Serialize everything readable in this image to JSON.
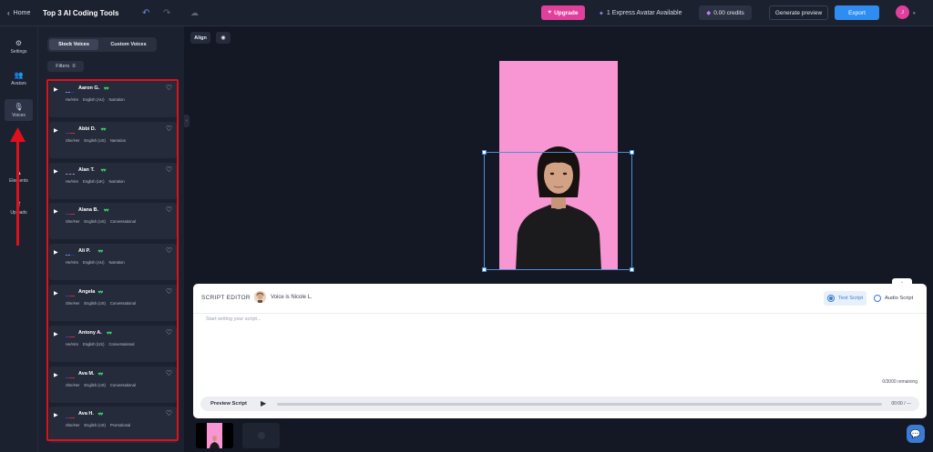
{
  "topbar": {
    "home_label": "Home",
    "project_title": "Top 3 AI Coding Tools",
    "upgrade_label": "Upgrade",
    "express_label": "1 Express Avatar Available",
    "credits_label": "0.00 credits",
    "generate_label": "Generate preview",
    "export_label": "Export",
    "user_initial": "J"
  },
  "rail": {
    "items": [
      {
        "label": "Settings"
      },
      {
        "label": "Avatars"
      },
      {
        "label": "Voices"
      },
      {
        "label": "Elements"
      },
      {
        "label": "Uploads"
      }
    ]
  },
  "panel": {
    "tabs": [
      "Stock Voices",
      "Custom Voices"
    ],
    "filters_label": "Filters",
    "voices": [
      {
        "name": "Aaron G.",
        "flag": "au",
        "gender": "He/Him",
        "accent": "English (AU)",
        "style": "Narration"
      },
      {
        "name": "Abbi D.",
        "flag": "us",
        "gender": "She/Her",
        "accent": "English (US)",
        "style": "Narration"
      },
      {
        "name": "Alan T.",
        "flag": "uk",
        "gender": "He/Him",
        "accent": "English (UK)",
        "style": "Narration"
      },
      {
        "name": "Alana B.",
        "flag": "us",
        "gender": "She/Her",
        "accent": "English (US)",
        "style": "Conversational"
      },
      {
        "name": "Ali P.",
        "flag": "au",
        "gender": "He/Him",
        "accent": "English (AU)",
        "style": "Narration"
      },
      {
        "name": "Angela",
        "flag": "us",
        "gender": "She/Her",
        "accent": "English (US)",
        "style": "Conversational"
      },
      {
        "name": "Antony A.",
        "flag": "us",
        "gender": "He/Him",
        "accent": "English (US)",
        "style": "Conversational"
      },
      {
        "name": "Ava M.",
        "flag": "us",
        "gender": "She/Her",
        "accent": "English (US)",
        "style": "Conversational"
      },
      {
        "name": "Ava H.",
        "flag": "us",
        "gender": "She/Her",
        "accent": "English (US)",
        "style": "Promotional"
      }
    ]
  },
  "canvas": {
    "align_label": "Align",
    "stage_color": "#f796d2",
    "selection_color": "#4b8fd9"
  },
  "editor": {
    "title": "SCRIPT EDITOR",
    "voice_label": "Voice is Nicole L.",
    "text_script_label": "Text Script",
    "audio_script_label": "Audio Script",
    "placeholder": "Start writing your script...",
    "char_count": "0/3000 remaining",
    "preview_label": "Preview Script",
    "time_label": "00:00 / ---"
  },
  "colors": {
    "accent_blue": "#3a7bd5",
    "upgrade_pink": "#e0409b",
    "annotation_red": "#e0101a",
    "wave_green": "#3ccf6c"
  }
}
